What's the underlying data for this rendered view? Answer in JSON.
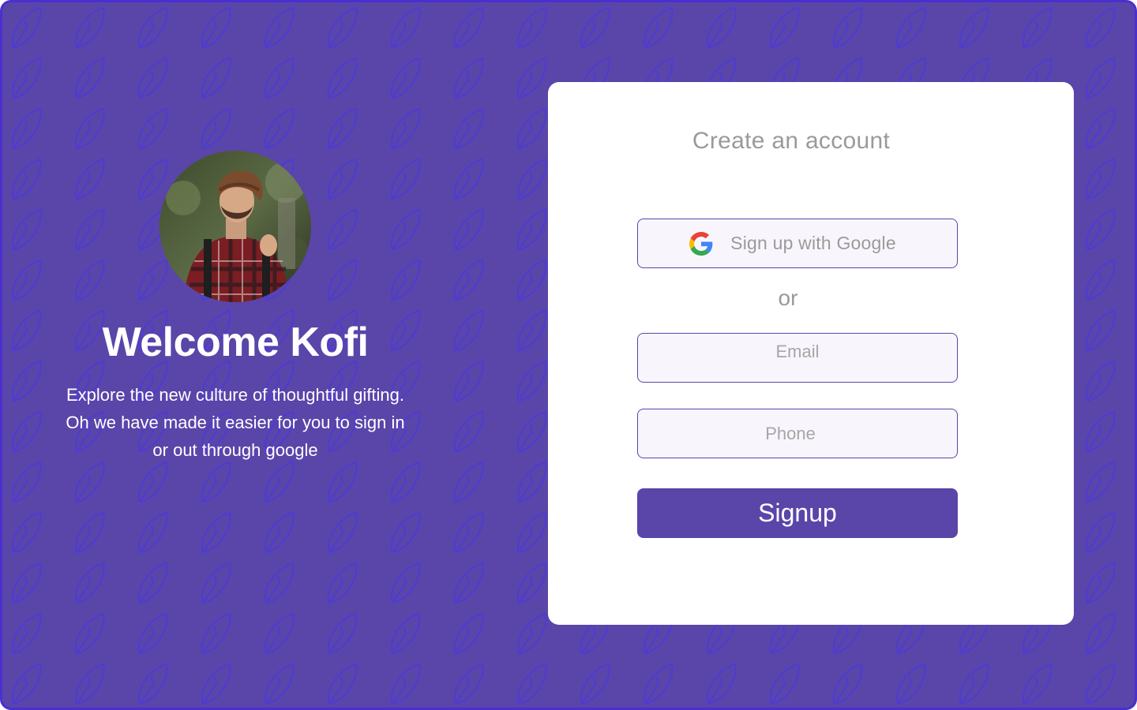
{
  "welcome": {
    "avatar_alt": "Profile photo of Kofi",
    "title": "Welcome Kofi",
    "description": "Explore the new culture of thoughtful gifting. Oh we have made it easier for you to sign in or out through google"
  },
  "card": {
    "title": "Create an account",
    "google_button_label": "Sign up with Google",
    "or_label": "or",
    "email": {
      "placeholder": "Email",
      "value": ""
    },
    "phone": {
      "placeholder": "Phone",
      "value": ""
    },
    "signup_button_label": "Signup"
  },
  "icons": {
    "pattern": "leaf-icon",
    "google": "google-icon"
  },
  "colors": {
    "background": "#5a45a9",
    "frame_border": "#4a2fd0",
    "pattern_stroke": "#4e3ccf",
    "card": "#ffffff",
    "muted_text": "#9a9a9a",
    "field_background": "#f8f6fc",
    "accent": "#5a45a9"
  }
}
